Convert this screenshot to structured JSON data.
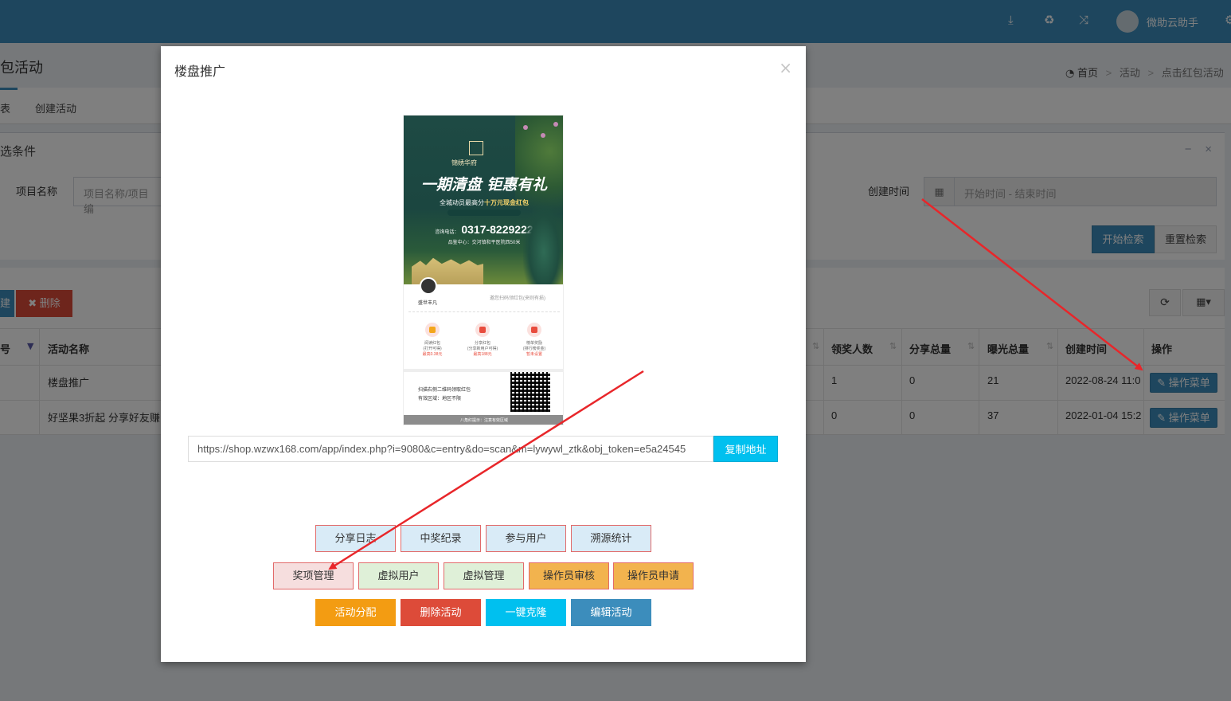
{
  "topbar": {
    "icons": [
      "download-icon",
      "recycle-icon",
      "shuffle-icon",
      "gear-icon"
    ],
    "user_name": "微助云助手"
  },
  "page": {
    "title": "包活动",
    "breadcrumb": {
      "home": "首页",
      "section": "活动",
      "current": "点击红包活动"
    }
  },
  "tabs": {
    "list_partial": "表",
    "create": "创建活动"
  },
  "filter": {
    "title": "选条件",
    "project_label": "项目名称",
    "project_placeholder": "项目名称/项目编",
    "time_label": "创建时间",
    "time_placeholder": "开始时间 - 结束时间",
    "search_button": "开始检索",
    "reset_button": "重置检索"
  },
  "toolbar": {
    "blue_partial": "建",
    "delete_label": "删除"
  },
  "table": {
    "headers": {
      "id": "号",
      "name": "活动名称",
      "winners": "领奖人数",
      "shares": "分享总量",
      "exposure": "曝光总量",
      "created": "创建时间",
      "actions": "操作"
    },
    "rows": [
      {
        "name": "楼盘推广",
        "winners": "1",
        "shares": "0",
        "exposure": "21",
        "created": "2022-08-24 11:0",
        "action": "操作菜单"
      },
      {
        "name": "好坚果3折起 分享好友赚",
        "winners": "0",
        "shares": "0",
        "exposure": "37",
        "created": "2022-01-04 15:2",
        "action": "操作菜单"
      }
    ]
  },
  "modal": {
    "title": "楼盘推广",
    "close": "×",
    "poster": {
      "brand": "锦绣华府",
      "headline": "一期清盘 钜惠有礼",
      "sub_prefix": "全城动员最高分",
      "sub_highlight": "十万元现金红包",
      "phone_label": "咨询电话：",
      "phone": "0317-8229222",
      "address": "品鉴中心：交河镇和平医院西50米",
      "user_name": "盛世丰凡",
      "note": "邀您扫码领红包(来则有损)",
      "rewards": [
        {
          "title": "阅读红包",
          "desc": "(打开可得)",
          "amount": "最高0.38元"
        },
        {
          "title": "分享红包",
          "desc": "(分享新用户可得)",
          "amount": "最高188元"
        },
        {
          "title": "榜单奖励",
          "desc": "(排行榜奖金)",
          "amount": "暂未设置"
        }
      ],
      "scan_text": "扫描右侧二维码领取红包",
      "region_text": "有效区域：地区不限",
      "footer": "八角红提示：注意有效区域"
    },
    "url": "https://shop.wzwx168.com/app/index.php?i=9080&c=entry&do=scan&m=lywywl_ztk&obj_token=e5a24545",
    "copy_button": "复制地址",
    "buttons_row1": [
      "分享日志",
      "中奖纪录",
      "参与用户",
      "溯源统计"
    ],
    "buttons_row2": [
      "奖项管理",
      "虚拟用户",
      "虚拟管理",
      "操作员审核",
      "操作员申请"
    ],
    "buttons_row3": [
      "活动分配",
      "删除活动",
      "一键克隆",
      "编辑活动"
    ]
  },
  "colors": {
    "primary": "#3c8dbc",
    "danger": "#dd4b39",
    "warning": "#f39c12",
    "info": "#00c0ef",
    "annotation_arrow": "#e8262a"
  }
}
